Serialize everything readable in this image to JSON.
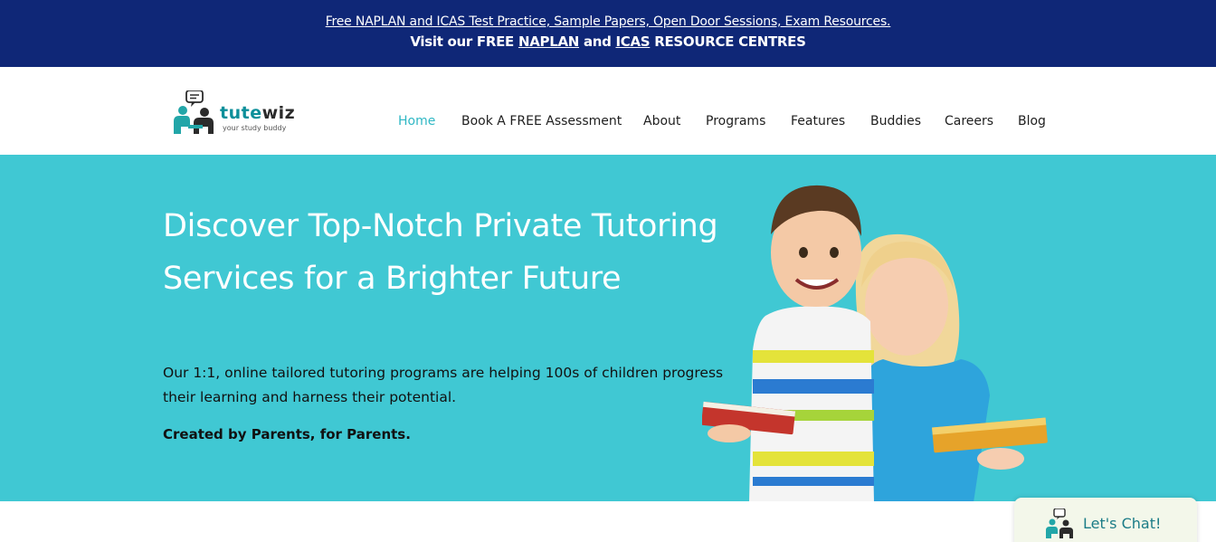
{
  "banner": {
    "line1": "Free NAPLAN and ICAS Test Practice, Sample Papers, Open Door Sessions, Exam Resources.",
    "line2_prefix": "Visit our FREE ",
    "naplan_link": "NAPLAN",
    "line2_and": " and ",
    "icas_link": "ICAS",
    "line2_suffix": " RESOURCE CENTRES"
  },
  "logo": {
    "brand_part1": "tute",
    "brand_part2": "wiz",
    "tagline": "your study buddy",
    "colors": {
      "teal": "#0c8f9a",
      "dark": "#2b2b2b"
    }
  },
  "nav": {
    "items": [
      {
        "label": "Home",
        "active": true
      },
      {
        "label": "Book A FREE Assessment",
        "active": false
      },
      {
        "label": "About",
        "active": false
      },
      {
        "label": "Programs",
        "active": false
      },
      {
        "label": "Features",
        "active": false
      },
      {
        "label": "Buddies",
        "active": false
      },
      {
        "label": "Careers",
        "active": false
      },
      {
        "label": "Blog",
        "active": false
      }
    ],
    "active_color": "#2fb7c4"
  },
  "hero": {
    "heading": "Discover Top-Notch Private Tutoring Services for a Brighter Future",
    "subtext": "Our 1:1, online tailored tutoring programs are helping 100s of children progress their learning and harness their potential.",
    "tagline": "Created by Parents, for Parents.",
    "background": "#40c8d3"
  },
  "chat": {
    "label": "Let's Chat!"
  },
  "colors": {
    "banner_bg": "#0f2777",
    "hero_bg": "#40c8d3",
    "chat_bg": "#f3f7ea"
  }
}
